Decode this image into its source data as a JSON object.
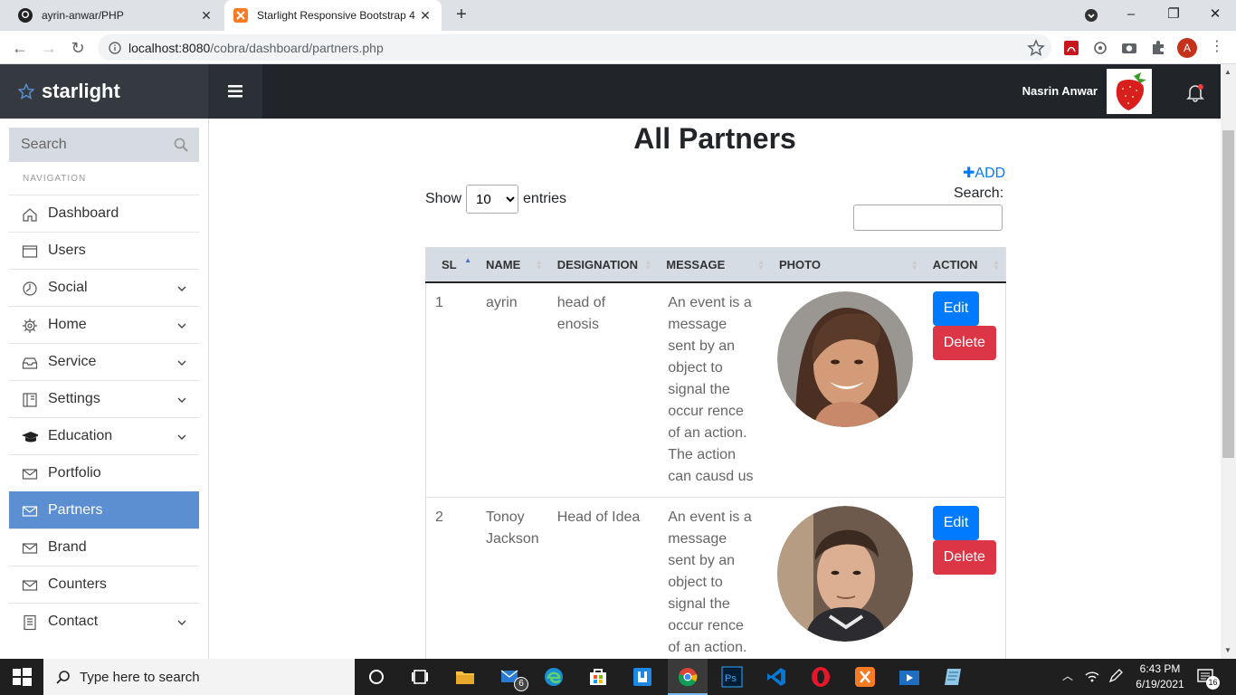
{
  "browser": {
    "tabs": [
      {
        "title": "ayrin-anwar/PHP",
        "active": false
      },
      {
        "title": "Starlight Responsive Bootstrap 4",
        "active": true
      }
    ],
    "url_host": "localhost:8080",
    "url_path": "/cobra/dashboard/partners.php",
    "new_tab": "+",
    "profile_initial": "A"
  },
  "app": {
    "brand": "starlight",
    "user_name": "Nasrin Anwar"
  },
  "sidebar": {
    "search_placeholder": "Search",
    "nav_heading": "NAVIGATION",
    "items": [
      {
        "label": "Dashboard",
        "icon": "home-icon",
        "dropdown": false,
        "active": false
      },
      {
        "label": "Users",
        "icon": "window-icon",
        "dropdown": false,
        "active": false
      },
      {
        "label": "Social",
        "icon": "clock-icon",
        "dropdown": true,
        "active": false
      },
      {
        "label": "Home",
        "icon": "gear-icon",
        "dropdown": true,
        "active": false
      },
      {
        "label": "Service",
        "icon": "inbox-icon",
        "dropdown": true,
        "active": false
      },
      {
        "label": "Settings",
        "icon": "book-icon",
        "dropdown": true,
        "active": false
      },
      {
        "label": "Education",
        "icon": "graduation-cap-icon",
        "dropdown": true,
        "active": false
      },
      {
        "label": "Portfolio",
        "icon": "envelope-icon",
        "dropdown": false,
        "active": false
      },
      {
        "label": "Partners",
        "icon": "envelope-icon",
        "dropdown": false,
        "active": true
      },
      {
        "label": "Brand",
        "icon": "envelope-icon",
        "dropdown": false,
        "active": false
      },
      {
        "label": "Counters",
        "icon": "envelope-icon",
        "dropdown": false,
        "active": false
      },
      {
        "label": "Contact",
        "icon": "document-icon",
        "dropdown": true,
        "active": false
      }
    ]
  },
  "main": {
    "title": "All Partners",
    "add_label": "ADD",
    "show_label": "Show",
    "entries_value": "10",
    "entries_label": "entries",
    "search_label": "Search:",
    "columns": [
      "SL",
      "NAME",
      "DESIGNATION",
      "MESSAGE",
      "PHOTO",
      "ACTION"
    ],
    "rows": [
      {
        "sl": "1",
        "name": "ayrin",
        "designation": "head of enosis",
        "message": "An event is a message sent by an object to signal the occur rence of an action. The action can causd us",
        "photo": "woman-portrait"
      },
      {
        "sl": "2",
        "name": "Tonoy Jackson",
        "designation": "Head of Idea",
        "message": "An event is a message sent by an object to signal the occur rence of an action. The action can causd us",
        "photo": "man-portrait"
      }
    ],
    "edit_label": "Edit",
    "delete_label": "Delete"
  },
  "taskbar": {
    "search_placeholder": "Type here to search",
    "mail_badge": "6",
    "time": "6:43 PM",
    "date": "6/19/2021",
    "notification_count": "16"
  },
  "colors": {
    "sidebar_active": "#5b8fd1",
    "edit_button": "#007bff",
    "delete_button": "#dc3545",
    "topbar": "#212529"
  }
}
